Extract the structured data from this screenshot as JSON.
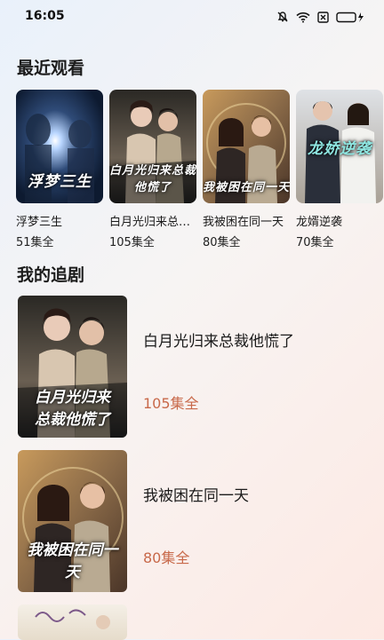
{
  "status_bar": {
    "time": "16:05"
  },
  "recent": {
    "title": "最近观看",
    "items": [
      {
        "name": "浮梦三生",
        "episodes": "51集全",
        "poster_text": "浮梦三生"
      },
      {
        "name": "白月光归来总裁他慌了",
        "episodes": "105集全",
        "poster_text": "白月光归来总裁他慌了"
      },
      {
        "name": "我被困在同一天",
        "episodes": "80集全",
        "poster_text": "我被困在同一天"
      },
      {
        "name": "龙婿逆袭",
        "episodes": "70集全",
        "poster_text": "龙娇逆袭"
      }
    ]
  },
  "following": {
    "title": "我的追剧",
    "items": [
      {
        "name": "白月光归来总裁他慌了",
        "episodes": "105集全",
        "poster_text": "白月光归来总裁他慌了"
      },
      {
        "name": "我被困在同一天",
        "episodes": "80集全",
        "poster_text": "我被困在同一天"
      }
    ]
  },
  "colors": {
    "episode_accent": "#c8694a"
  }
}
